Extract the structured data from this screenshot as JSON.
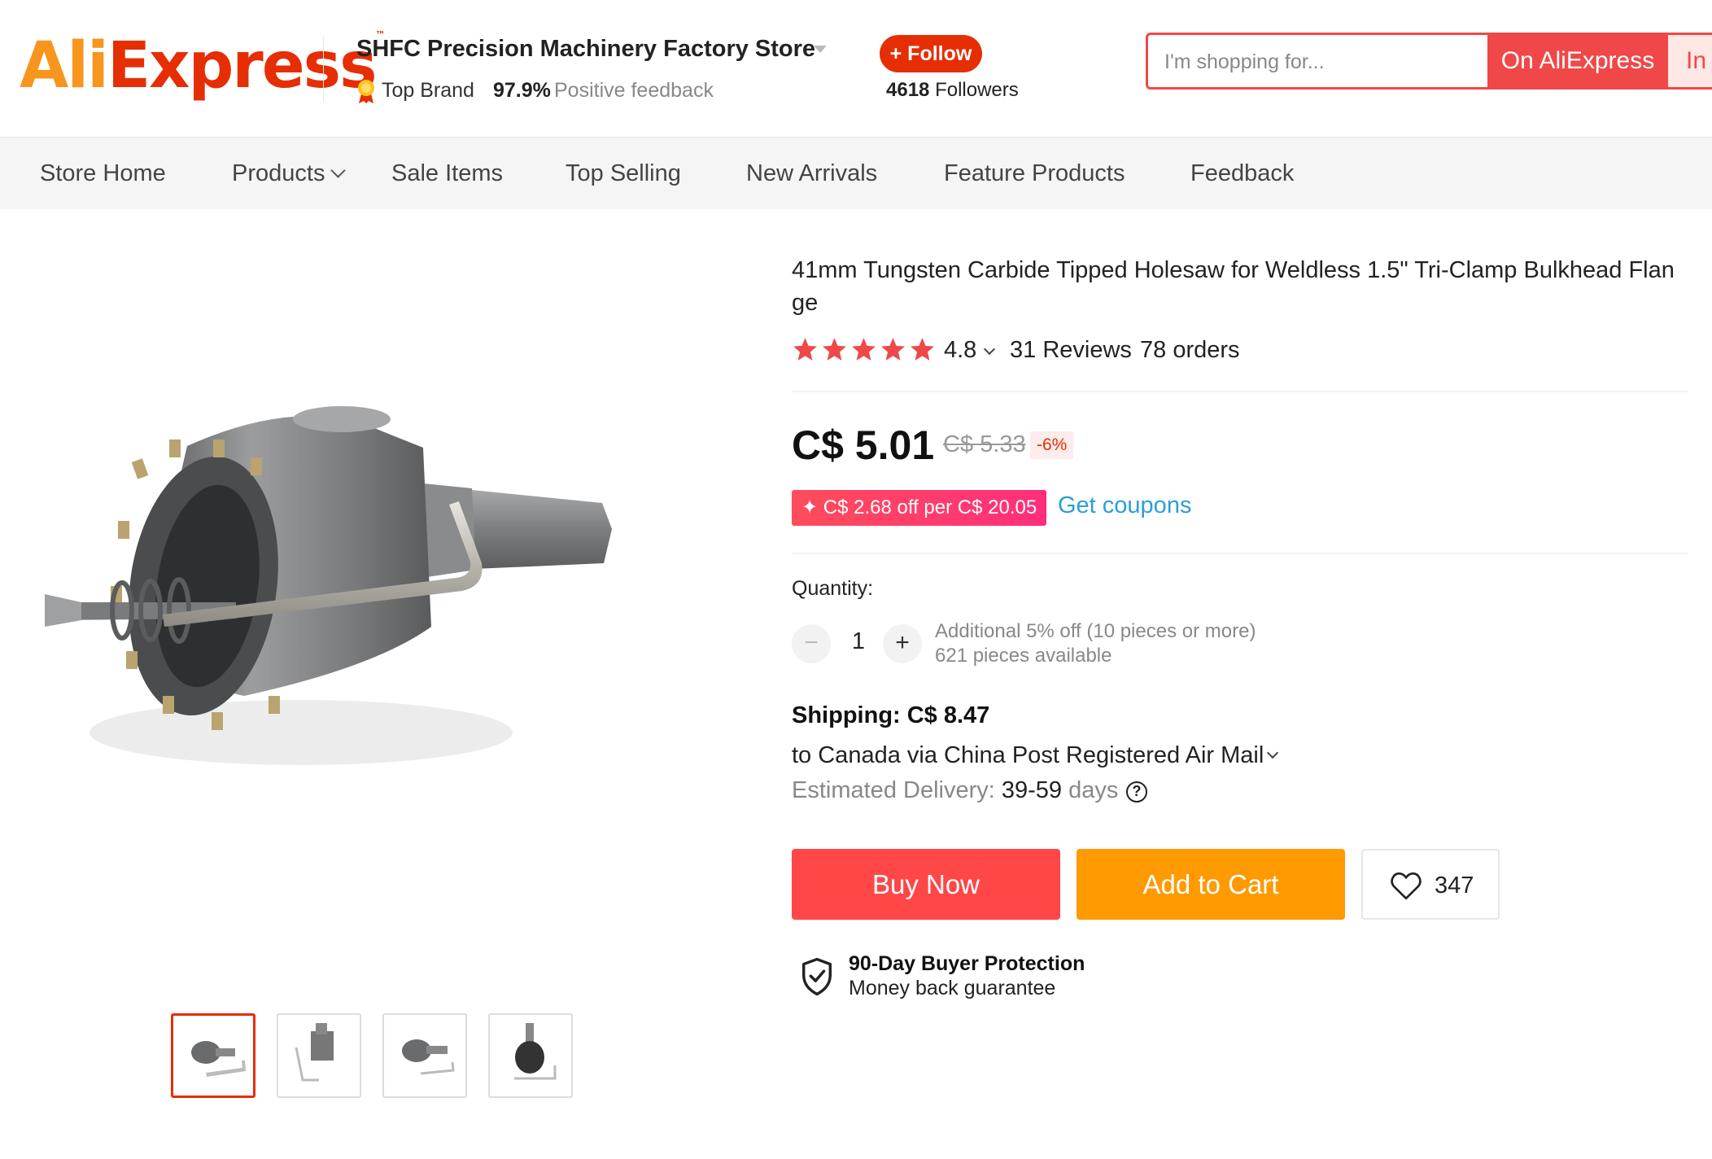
{
  "header": {
    "logo": {
      "part1": "Ali",
      "part2": "Express",
      "tm": "™"
    },
    "store_name": "SHFC Precision Machinery Factory Store",
    "top_brand": "Top Brand",
    "positive_pct": "97.9%",
    "positive_label": "Positive feedback",
    "follow_label": "+ Follow",
    "followers_count": "4618",
    "followers_label": "Followers",
    "search_placeholder": "I'm shopping for...",
    "search_button": "On AliExpress",
    "in_button": "In"
  },
  "nav": {
    "items": [
      {
        "label": "Store Home"
      },
      {
        "label": "Products"
      },
      {
        "label": "Sale Items"
      },
      {
        "label": "Top Selling"
      },
      {
        "label": "New Arrivals"
      },
      {
        "label": "Feature Products"
      },
      {
        "label": "Feedback"
      }
    ]
  },
  "product": {
    "title": "41mm Tungsten Carbide Tipped Holesaw for Weldless 1.5\" Tri-Clamp Bulkhead Flan ge",
    "rating": "4.8",
    "stars": 5,
    "reviews": "31 Reviews",
    "orders": "78 orders",
    "price": "C$ 5.01",
    "original_price": "C$ 5.33",
    "discount": "-6%",
    "coupon": "✦ C$ 2.68 off per C$ 20.05",
    "get_coupons": "Get coupons",
    "quantity_label": "Quantity:",
    "quantity_value": "1",
    "qty_discount": "Additional 5% off (10 pieces or more)",
    "qty_available": "621 pieces available",
    "shipping_label": "Shipping: C$ 8.47",
    "shipping_to": "to Canada via China Post Registered Air Mail",
    "est_label": "Estimated Delivery:",
    "est_days": "39-59",
    "est_unit": "days",
    "buy_now": "Buy Now",
    "add_to_cart": "Add to Cart",
    "wishlist_count": "347",
    "protection_title": "90-Day Buyer Protection",
    "protection_sub": "Money back guarantee"
  },
  "colors": {
    "brand_red": "#e62e04",
    "buy_red": "#ff4747",
    "cart_orange": "#ff9a00",
    "link_blue": "#2a9fd6",
    "star_red": "#f04848"
  },
  "icons": [
    "medal-icon",
    "chevron-down-icon",
    "star-icon",
    "help-icon",
    "heart-icon",
    "shield-check-icon"
  ]
}
